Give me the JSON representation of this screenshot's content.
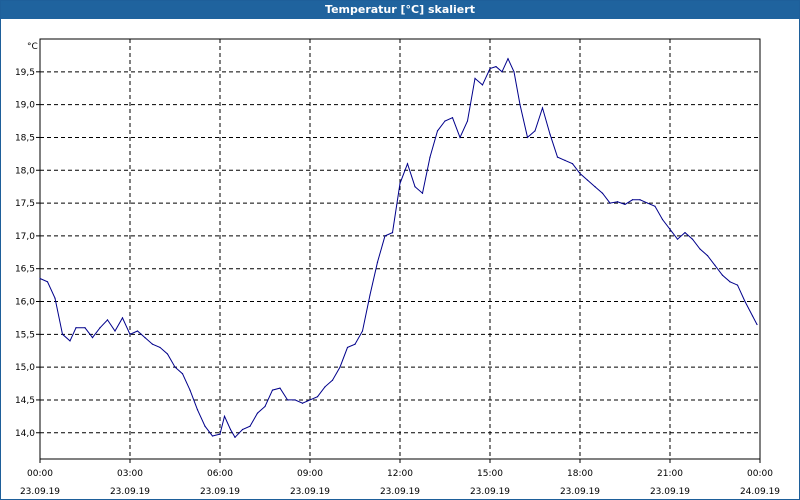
{
  "window": {
    "title": "Temperatur [°C] skaliert"
  },
  "chart_data": {
    "type": "line",
    "title": "Temperatur [°C] skaliert",
    "ylabel": "°C",
    "xlabel": "",
    "ylim": [
      13.6,
      20.0
    ],
    "xlim": [
      0,
      24
    ],
    "grid": true,
    "grid_style": "dashed",
    "line_color": "#00008b",
    "x_ticks": [
      {
        "x": 0,
        "time": "00:00",
        "date": "23.09.19"
      },
      {
        "x": 3,
        "time": "03:00",
        "date": "23.09.19"
      },
      {
        "x": 6,
        "time": "06:00",
        "date": "23.09.19"
      },
      {
        "x": 9,
        "time": "09:00",
        "date": "23.09.19"
      },
      {
        "x": 12,
        "time": "12:00",
        "date": "23.09.19"
      },
      {
        "x": 15,
        "time": "15:00",
        "date": "23.09.19"
      },
      {
        "x": 18,
        "time": "18:00",
        "date": "23.09.19"
      },
      {
        "x": 21,
        "time": "21:00",
        "date": "23.09.19"
      },
      {
        "x": 24,
        "time": "00:00",
        "date": "24.09.19"
      }
    ],
    "y_ticks": [
      {
        "v": 14.0,
        "label": "14,0"
      },
      {
        "v": 14.5,
        "label": "14,5"
      },
      {
        "v": 15.0,
        "label": "15,0"
      },
      {
        "v": 15.5,
        "label": "15,5"
      },
      {
        "v": 16.0,
        "label": "16,0"
      },
      {
        "v": 16.5,
        "label": "16,5"
      },
      {
        "v": 17.0,
        "label": "17,0"
      },
      {
        "v": 17.5,
        "label": "17,5"
      },
      {
        "v": 18.0,
        "label": "18,0"
      },
      {
        "v": 18.5,
        "label": "18,5"
      },
      {
        "v": 19.0,
        "label": "19,0"
      },
      {
        "v": 19.5,
        "label": "19,5"
      }
    ],
    "series": [
      {
        "x": [
          0,
          0.25,
          0.5,
          0.75,
          1.0,
          1.2,
          1.5,
          1.75,
          2.0,
          2.25,
          2.5,
          2.75,
          3.0,
          3.25,
          3.5,
          3.75,
          4.0,
          4.25,
          4.5,
          4.75,
          5.0,
          5.25,
          5.5,
          5.75,
          6.0,
          6.15,
          6.35,
          6.5,
          6.75,
          7.0,
          7.25,
          7.5,
          7.75,
          8.0,
          8.25,
          8.5,
          8.75,
          9.0,
          9.25,
          9.5,
          9.75,
          10.0,
          10.25,
          10.5,
          10.75,
          11.0,
          11.25,
          11.5,
          11.75,
          12.0,
          12.25,
          12.5,
          12.75,
          13.0,
          13.25,
          13.5,
          13.75,
          14.0,
          14.25,
          14.5,
          14.75,
          15.0,
          15.2,
          15.4,
          15.6,
          15.8,
          16.0,
          16.25,
          16.5,
          16.75,
          17.0,
          17.25,
          17.5,
          17.75,
          18.0,
          18.25,
          18.5,
          18.75,
          19.0,
          19.25,
          19.5,
          19.75,
          20.0,
          20.25,
          20.5,
          20.75,
          21.0,
          21.25,
          21.5,
          21.75,
          22.0,
          22.25,
          22.5,
          22.75,
          23.0,
          23.25,
          23.5,
          23.75,
          23.9
        ],
        "y": [
          16.35,
          16.3,
          16.05,
          15.5,
          15.4,
          15.6,
          15.6,
          15.45,
          15.6,
          15.72,
          15.55,
          15.75,
          15.5,
          15.55,
          15.45,
          15.35,
          15.3,
          15.2,
          15.0,
          14.9,
          14.65,
          14.35,
          14.1,
          13.95,
          13.98,
          14.25,
          14.05,
          13.93,
          14.05,
          14.1,
          14.3,
          14.4,
          14.65,
          14.68,
          14.5,
          14.5,
          14.45,
          14.5,
          14.55,
          14.7,
          14.8,
          15.0,
          15.3,
          15.35,
          15.55,
          16.1,
          16.6,
          17.0,
          17.05,
          17.8,
          18.1,
          17.75,
          17.65,
          18.2,
          18.6,
          18.75,
          18.8,
          18.5,
          18.75,
          19.4,
          19.3,
          19.55,
          19.58,
          19.5,
          19.7,
          19.5,
          19.0,
          18.5,
          18.6,
          18.95,
          18.55,
          18.2,
          18.15,
          18.1,
          17.95,
          17.85,
          17.75,
          17.65,
          17.5,
          17.52,
          17.48,
          17.55,
          17.55,
          17.5,
          17.45,
          17.25,
          17.1,
          16.95,
          17.05,
          16.95,
          16.8,
          16.7,
          16.55,
          16.4,
          16.3,
          16.25,
          16.0,
          15.78,
          15.65
        ]
      }
    ]
  }
}
